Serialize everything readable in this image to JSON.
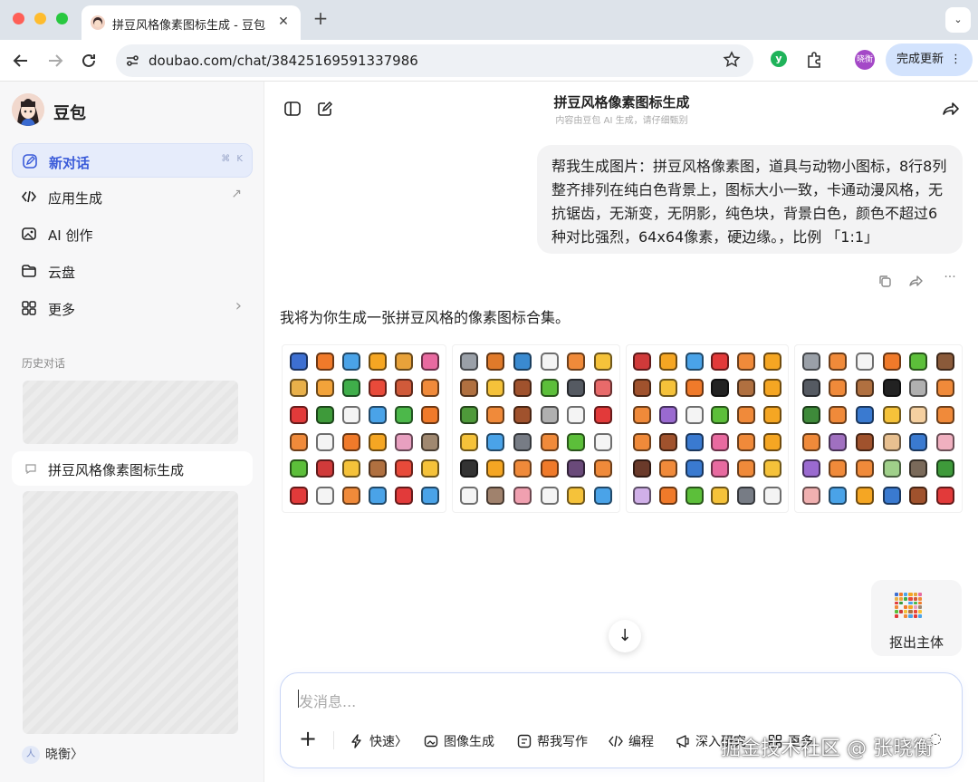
{
  "browser": {
    "tab_title": "拼豆风格像素图标生成 - 豆包",
    "tab_close": "✕",
    "new_tab": "+",
    "tab_menu": "⌄",
    "url": "doubao.com/chat/38425169591337986",
    "profile_initials": "晓衡",
    "update_button": "完成更新",
    "update_more": "⋮",
    "icons": [
      "back-icon",
      "forward-icon",
      "reload-icon",
      "site-info-icon",
      "star-icon",
      "extension-icon",
      "puzzle-icon"
    ]
  },
  "sidebar": {
    "brand": "豆包",
    "items": [
      {
        "label": "新对话",
        "icon": "new-chat-icon",
        "shortcut": "⌘ K"
      },
      {
        "label": "应用生成",
        "icon": "code-icon",
        "trailing": "↗"
      },
      {
        "label": "AI 创作",
        "icon": "image-icon"
      },
      {
        "label": "云盘",
        "icon": "folder-icon"
      },
      {
        "label": "更多",
        "icon": "grid-icon",
        "trailing": "›"
      }
    ],
    "history_label": "历史对话",
    "history_active": "拼豆风格像素图标生成",
    "user_name": "晓衡〉",
    "user_initial": "人"
  },
  "chat": {
    "title": "拼豆风格像素图标生成",
    "subtitle": "内容由豆包 AI 生成，请仔细甄别",
    "user_message": "帮我生成图片：拼豆风格像素图，道具与动物小图标，8行8列整齐排列在纯白色背景上，图标大小一致，卡通动漫风格，无抗锯齿，无渐变，无阴影，纯色块，背景白色，颜色不超过6种对比强烈，64x64像素，硬边缘。，比例 「1:1」",
    "reply_text": "我将为你生成一张拼豆风格的像素图标合集。",
    "extract_label": "抠出主体",
    "scroll_down": "↓",
    "message_actions": [
      "copy-icon",
      "share-icon",
      "more-icon"
    ],
    "more_dots": "···",
    "panels": [
      [
        "#3d6fd1",
        "#f07a2a",
        "#4aa3e8",
        "#f5a623",
        "#e8a23a",
        "#e86aa0",
        "#e8b04a",
        "#f2a33a",
        "#3fae4a",
        "#e84a3a",
        "#d05a3a",
        "#f08a3a",
        "#e23a3a",
        "#3e9a3a",
        "#f4f4f4",
        "#4aa3e8",
        "#4cb84a",
        "#f07a2a",
        "#f08a3a",
        "#f4f4f4",
        "#f07a2a",
        "#f5a623",
        "#e8a0c0",
        "#a08870",
        "#5cbf3a",
        "#d03a3a",
        "#f5c23a",
        "#b07040",
        "#e84a3a",
        "#f5c23a",
        "#e23a3a",
        "#f4f4f4",
        "#f08a3a",
        "#4aa3e8",
        "#e23a3a",
        "#4aa3e8"
      ],
      [
        "#9aa0a8",
        "#e07a2a",
        "#3a8ad0",
        "#f4f4f4",
        "#f08a3a",
        "#f5c23a",
        "#b07040",
        "#f5c23a",
        "#a0522d",
        "#5cbf3a",
        "#555a62",
        "#e86a6a",
        "#4e9a3a",
        "#f08a3a",
        "#a0522d",
        "#b0b0b0",
        "#f4f4f4",
        "#e23a3a",
        "#f5c23a",
        "#4aa3e8",
        "#777c85",
        "#f08a3a",
        "#5cbf3a",
        "#f4f4f4",
        "#333333",
        "#f5a623",
        "#f08a3a",
        "#f07a2a",
        "#6a4a7a",
        "#f08a3a",
        "#f4f4f4",
        "#a0826d",
        "#f0a0b0",
        "#f4f4f4",
        "#f5c23a",
        "#4aa3e8"
      ],
      [
        "#d03a3a",
        "#f5a623",
        "#4aa3e8",
        "#e23a3a",
        "#f08a3a",
        "#f5a623",
        "#a0522d",
        "#f5c23a",
        "#f07a2a",
        "#222222",
        "#b07040",
        "#f5a623",
        "#f08a3a",
        "#9a6ad0",
        "#f4f4f4",
        "#5cbf3a",
        "#f08a3a",
        "#f5a623",
        "#f08a3a",
        "#a0522d",
        "#3a7ad0",
        "#e86aa0",
        "#f08a3a",
        "#f5a623",
        "#6a3a2a",
        "#f08a3a",
        "#3a7ad0",
        "#e86aa0",
        "#f08a3a",
        "#f5c23a",
        "#d0b0e8",
        "#f07a2a",
        "#5cbf3a",
        "#f5c23a",
        "#777c85",
        "#f4f4f4"
      ],
      [
        "#9aa0a8",
        "#f08a3a",
        "#f4f4f4",
        "#f07a2a",
        "#5cbf3a",
        "#8a5a3a",
        "#555a62",
        "#f08a3a",
        "#b07040",
        "#222222",
        "#b0b0b0",
        "#f08a3a",
        "#3e8a3a",
        "#f08a3a",
        "#3a7ad0",
        "#f5c23a",
        "#f5d0a0",
        "#f08a3a",
        "#f08a3a",
        "#a070c0",
        "#a0522d",
        "#e8c090",
        "#3a7ad0",
        "#f0b0c0",
        "#9a6ad0",
        "#f08a3a",
        "#f08a3a",
        "#a0d08a",
        "#7a6a5a",
        "#3e9a3a",
        "#f0b0b0",
        "#4aa3e8",
        "#f5a623",
        "#3a7ad0",
        "#a0522d",
        "#e23a3a"
      ]
    ]
  },
  "composer": {
    "placeholder": "发消息...",
    "plus": "+",
    "tools": [
      {
        "label": "快速〉",
        "icon": "bolt-icon"
      },
      {
        "label": "图像生成",
        "icon": "image-gen-icon"
      },
      {
        "label": "帮我写作",
        "icon": "write-icon"
      },
      {
        "label": "编程",
        "icon": "code-icon"
      },
      {
        "label": "深入研究",
        "icon": "research-icon"
      },
      {
        "label": "更多",
        "icon": "grid-icon"
      }
    ],
    "mic": "◌"
  },
  "watermark": "掘金技术社区 @ 张晓衡",
  "colors": {
    "accent": "#3a5bd9",
    "active_item_bg": "#e6ecfb",
    "update_bg": "#d3e3fd"
  }
}
